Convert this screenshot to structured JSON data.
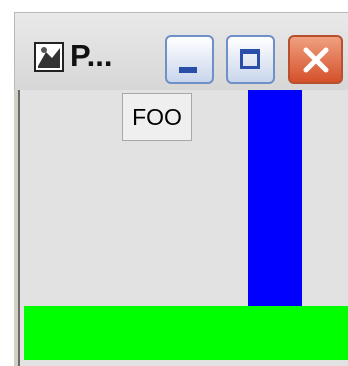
{
  "window": {
    "title": "P...",
    "buttons": {
      "minimize": "minimize",
      "maximize": "maximize",
      "close": "close"
    }
  },
  "content": {
    "label": "FOO"
  },
  "colors": {
    "blue_bar": "#0000ff",
    "green_bar": "#00ff00",
    "close_button": "#d4512b"
  },
  "icons": {
    "app": "app-icon",
    "minimize": "minimize-icon",
    "maximize": "maximize-icon",
    "close": "close-icon"
  }
}
